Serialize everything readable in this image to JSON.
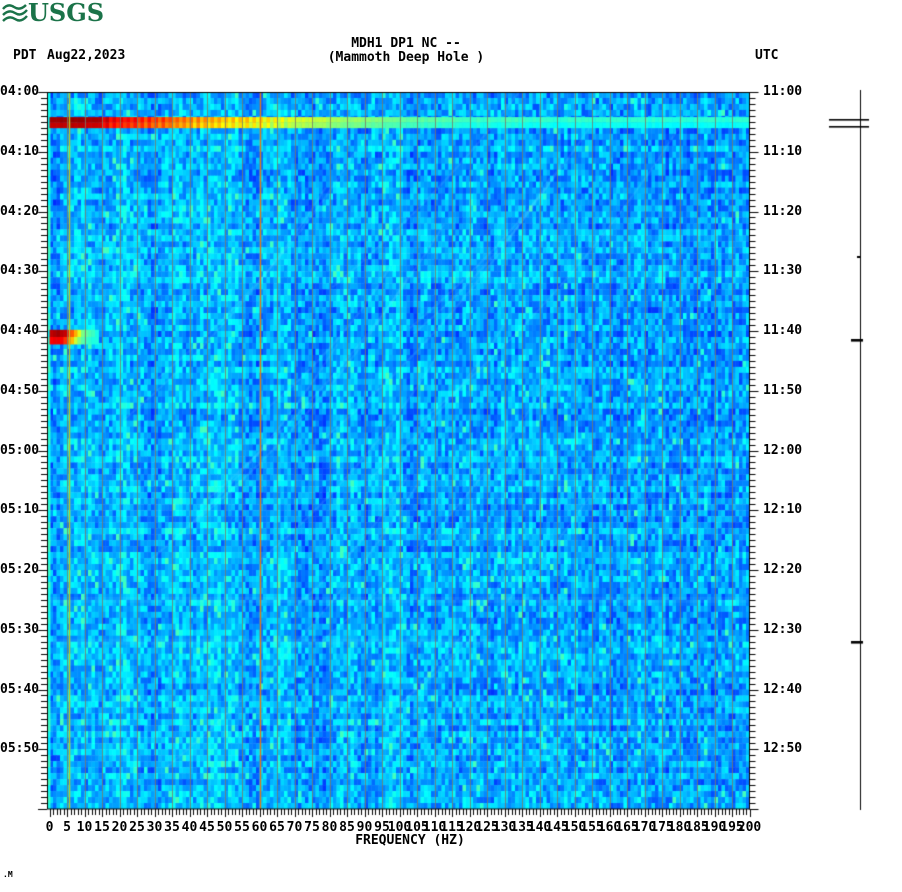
{
  "header": {
    "logo_text": "USGS",
    "tz_left": "PDT",
    "date": "Aug22,2023",
    "title": "MDH1 DP1 NC --",
    "subtitle": "(Mammoth Deep Hole )",
    "tz_right": "UTC"
  },
  "watermark": ".M",
  "chart_data": {
    "type": "heatmap",
    "title": "MDH1 DP1 NC -- (Mammoth Deep Hole ) seismic spectrogram",
    "xlabel": "FREQUENCY (HZ)",
    "x_range_hz": [
      0,
      200
    ],
    "x_major_tick_step_hz": 5,
    "x_minor_tick_step_hz": 1,
    "x_tick_labels": [
      "0",
      "5",
      "10",
      "15",
      "20",
      "25",
      "30",
      "35",
      "40",
      "45",
      "50",
      "55",
      "60",
      "65",
      "70",
      "75",
      "80",
      "85",
      "90",
      "95",
      "100",
      "105",
      "110",
      "115",
      "120",
      "125",
      "130",
      "135",
      "140",
      "145",
      "150",
      "155",
      "160",
      "165",
      "170",
      "175",
      "180",
      "185",
      "190",
      "195",
      "200"
    ],
    "time_axis_left_pdt": [
      "04:00",
      "04:10",
      "04:20",
      "04:30",
      "04:40",
      "04:50",
      "05:00",
      "05:10",
      "05:20",
      "05:30",
      "05:40",
      "05:50"
    ],
    "time_axis_right_utc": [
      "11:00",
      "11:10",
      "11:20",
      "11:30",
      "11:40",
      "11:50",
      "12:00",
      "12:10",
      "12:20",
      "12:30",
      "12:40",
      "12:50"
    ],
    "time_span_minutes": 120,
    "minor_time_tick_minutes": 1,
    "major_time_tick_minutes": 10,
    "grid_on": true,
    "grid_step_hz": 5,
    "grid_color": "#7b7b66",
    "legend_position": "none",
    "colormap": "jet",
    "background_levels": {
      "base": 0.3,
      "min": 0.14,
      "max": 0.44
    },
    "noise_lines": [
      {
        "hz": 5.7,
        "color": "#bec81e"
      },
      {
        "hz": 60,
        "color": "#e07814"
      }
    ],
    "events": [
      {
        "start_pdt": "04:04",
        "end_pdt": "04:06",
        "start_utc": "11:04",
        "start_min": 4.2,
        "end_min": 6.0,
        "freq_range_hz": [
          0,
          200
        ],
        "description": "strong broadband event, dark red at low frequency fading to cyan at high frequency",
        "low_freq_color": "#8b0000",
        "comb_band_hz": [
          14,
          68
        ],
        "profile_v": [
          [
            0,
            0.97
          ],
          [
            14,
            0.95
          ],
          [
            20,
            0.9
          ],
          [
            30,
            0.84
          ],
          [
            40,
            0.76
          ],
          [
            50,
            0.7
          ],
          [
            60,
            0.66
          ],
          [
            70,
            0.58
          ],
          [
            85,
            0.52
          ],
          [
            100,
            0.47
          ],
          [
            120,
            0.43
          ],
          [
            150,
            0.41
          ],
          [
            200,
            0.4
          ]
        ]
      },
      {
        "start_pdt": "04:40",
        "end_pdt": "04:42",
        "start_utc": "11:40",
        "start_min": 39.8,
        "end_min": 42.2,
        "freq_range_hz": [
          0,
          13
        ],
        "description": "moderate low-frequency event, dark red core 1-5 Hz with yellow fringe and cyan tail",
        "low_freq_color": "#990000",
        "row_profiles_v": [
          [
            [
              0,
              0.93
            ],
            [
              2,
              0.96
            ],
            [
              4,
              0.93
            ],
            [
              5,
              0.86
            ],
            [
              6,
              0.78
            ],
            [
              7,
              0.7
            ],
            [
              8,
              0.6
            ],
            [
              9,
              0.5
            ],
            [
              11,
              0.44
            ],
            [
              13,
              0.41
            ]
          ],
          [
            [
              0,
              0.88
            ],
            [
              3,
              0.88
            ],
            [
              5,
              0.78
            ],
            [
              6,
              0.68
            ],
            [
              7,
              0.58
            ],
            [
              8,
              0.5
            ],
            [
              10,
              0.43
            ],
            [
              13,
              0.4
            ]
          ]
        ]
      }
    ]
  },
  "trace_panel": {
    "description": "amplitude trace aligned with time axis",
    "blips": [
      {
        "y_frac": 0.039,
        "size": "large"
      },
      {
        "y_frac": 0.23,
        "size": "dot"
      },
      {
        "y_frac": 0.346,
        "size": "small"
      },
      {
        "y_frac": 0.767,
        "size": "small"
      }
    ]
  }
}
